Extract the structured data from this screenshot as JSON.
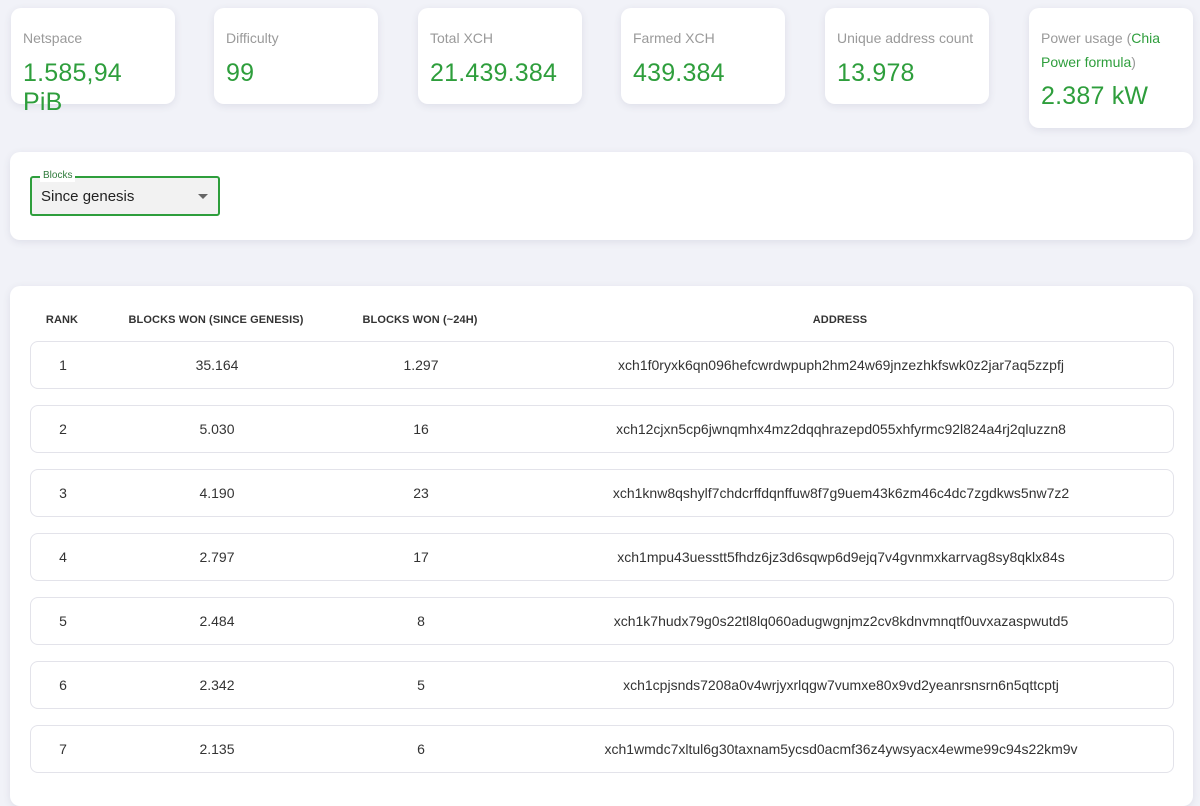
{
  "stats": {
    "netspace": {
      "label": "Netspace",
      "value": "1.585,94 PiB"
    },
    "difficulty": {
      "label": "Difficulty",
      "value": "99"
    },
    "total_xch": {
      "label": "Total XCH",
      "value": "21.439.384"
    },
    "farmed_xch": {
      "label": "Farmed XCH",
      "value": "439.384"
    },
    "unique_addresses": {
      "label": "Unique address count",
      "value": "13.978"
    },
    "power_usage": {
      "label_prefix": "Power usage (",
      "link_text": "Chia Power formula",
      "label_suffix": ")",
      "value": "2.387 kW"
    }
  },
  "filter": {
    "legend": "Blocks",
    "selected": "Since genesis"
  },
  "table": {
    "headers": {
      "rank": "Rank",
      "blocks_won": "Blocks won (since genesis)",
      "blocks_24h": "Blocks won (~24h)",
      "address": "Address"
    },
    "rows": [
      {
        "rank": "1",
        "blocks_won": "35.164",
        "blocks_24h": "1.297",
        "address": "xch1f0ryxk6qn096hefcwrdwpuph2hm24w69jnzezhkfswk0z2jar7aq5zzpfj"
      },
      {
        "rank": "2",
        "blocks_won": "5.030",
        "blocks_24h": "16",
        "address": "xch12cjxn5cp6jwnqmhx4mz2dqqhrazepd055xhfyrmc92l824a4rj2qluzzn8"
      },
      {
        "rank": "3",
        "blocks_won": "4.190",
        "blocks_24h": "23",
        "address": "xch1knw8qshylf7chdcrffdqnffuw8f7g9uem43k6zm46c4dc7zgdkws5nw7z2"
      },
      {
        "rank": "4",
        "blocks_won": "2.797",
        "blocks_24h": "17",
        "address": "xch1mpu43uesstt5fhdz6jz3d6sqwp6d9ejq7v4gvnmxkarrvag8sy8qklx84s"
      },
      {
        "rank": "5",
        "blocks_won": "2.484",
        "blocks_24h": "8",
        "address": "xch1k7hudx79g0s22tl8lq060adugwgnjmz2cv8kdnvmnqtf0uvxazaspwutd5"
      },
      {
        "rank": "6",
        "blocks_won": "2.342",
        "blocks_24h": "5",
        "address": "xch1cpjsnds7208a0v4wrjyxrlqgw7vumxe80x9vd2yeanrsnsrn6n5qttcptj"
      },
      {
        "rank": "7",
        "blocks_won": "2.135",
        "blocks_24h": "6",
        "address": "xch1wmdc7xltul6g30taxnam5ycsd0acmf36z4ywsyacx4ewme99c94s22km9v"
      }
    ]
  },
  "colors": {
    "accent": "#2e9e3c",
    "background": "#f1f2f8"
  }
}
